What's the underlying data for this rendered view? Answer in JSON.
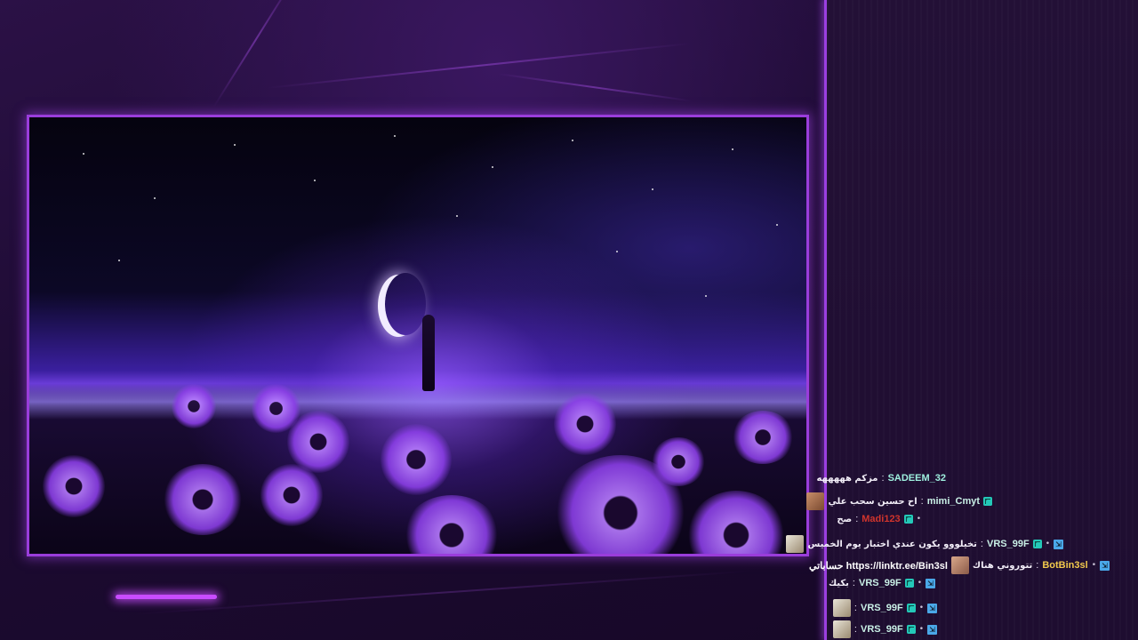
{
  "stream": {
    "accent_color": "#9a3ddb",
    "glow_color": "#c84cff"
  },
  "chat": {
    "messages": [
      {
        "user": "SADEEM_32",
        "user_color": "#9ff0df",
        "text": "مزكم هههههه",
        "badges": [],
        "emote": null,
        "extra": null
      },
      {
        "user": "mimi_Cmyt",
        "user_color": "#c9f0e6",
        "text": "اح حسين سحب علي",
        "badges": [
          "subscriber"
        ],
        "emote": "mimi",
        "extra": null
      },
      {
        "user": "Madi123",
        "user_color": "#d0342c",
        "text": "صح",
        "badges": [
          "dot",
          "subscriber"
        ],
        "emote": null,
        "extra": null
      },
      {
        "user": "VRS_99F",
        "user_color": "#c9f0e6",
        "text": "تخيلووو يكون عندي اختبار يوم الخميس",
        "badges": [
          "moderator",
          "dot",
          "subscriber"
        ],
        "emote": "cat",
        "extra": null
      },
      {
        "user": "BotBin3sl",
        "user_color": "#f2c94c",
        "text": "تتوروني هناك",
        "badges": [
          "moderator",
          "dot"
        ],
        "emote": "bot",
        "extra": "حساباتي https://linktr.ee/Bin3sl"
      },
      {
        "user": "VRS_99F",
        "user_color": "#c9f0e6",
        "text": "بكيك",
        "badges": [
          "moderator",
          "dot",
          "subscriber"
        ],
        "emote": null,
        "extra": null
      },
      {
        "user": "VRS_99F",
        "user_color": "#c9f0e6",
        "text": "",
        "badges": [
          "moderator",
          "dot",
          "subscriber"
        ],
        "emote": "cat",
        "extra": null
      },
      {
        "user": "VRS_99F",
        "user_color": "#c9f0e6",
        "text": "",
        "badges": [
          "moderator",
          "dot",
          "subscriber"
        ],
        "emote": "cat",
        "extra": null
      }
    ],
    "separator": ":"
  }
}
